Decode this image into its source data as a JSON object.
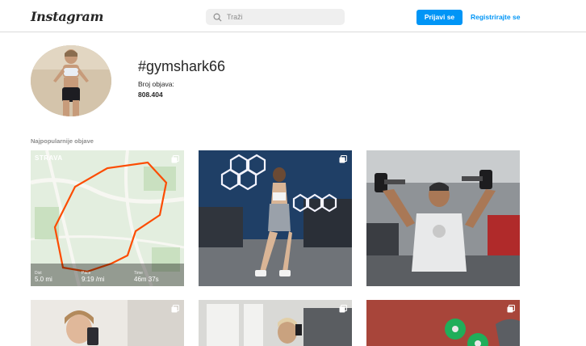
{
  "header": {
    "logo": "Instagram",
    "search_placeholder": "Traži",
    "login_label": "Prijavi se",
    "register_label": "Registrirajte se"
  },
  "profile": {
    "hashtag": "#gymshark66",
    "posts_label": "Broj objava:",
    "posts_count": "808.404"
  },
  "top_posts": {
    "section_label": "Najpopularnije objave",
    "strava": {
      "brand": "STRAVA",
      "stats": [
        {
          "name": "Dist",
          "value": "5.0 mi"
        },
        {
          "name": "Pace",
          "value": "9:19 /mi"
        },
        {
          "name": "Time",
          "value": "46m 37s"
        }
      ]
    }
  },
  "colors": {
    "accent": "#0095f6",
    "border": "#dbdbdb",
    "muted": "#8e8e8e"
  },
  "icons": [
    "search-icon",
    "multiple-posts-icon"
  ]
}
